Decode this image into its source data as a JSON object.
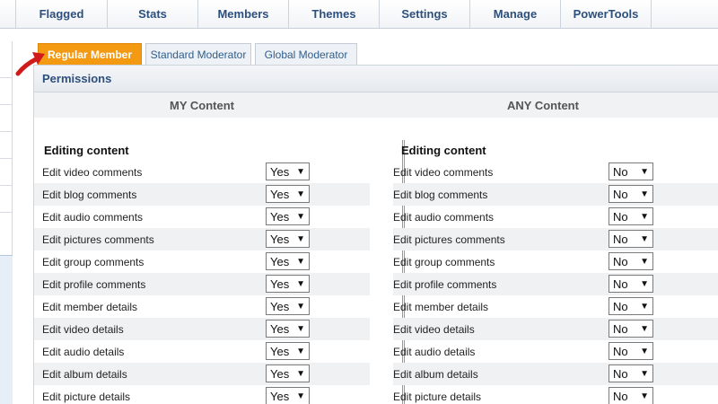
{
  "nav": {
    "items": [
      {
        "label": "Flagged"
      },
      {
        "label": "Stats"
      },
      {
        "label": "Members"
      },
      {
        "label": "Themes"
      },
      {
        "label": "Settings"
      },
      {
        "label": "Manage"
      },
      {
        "label": "PowerTools"
      }
    ]
  },
  "tabs": [
    {
      "label": "Regular Member",
      "active": true
    },
    {
      "label": "Standard Moderator",
      "active": false
    },
    {
      "label": "Global Moderator",
      "active": false
    }
  ],
  "panel": {
    "title": "Permissions",
    "my_title": "MY Content",
    "any_title": "ANY Content",
    "section_title": "Editing content"
  },
  "permissions": [
    {
      "label": "Edit video comments",
      "my": "Yes",
      "any": "No"
    },
    {
      "label": "Edit blog comments",
      "my": "Yes",
      "any": "No"
    },
    {
      "label": "Edit audio comments",
      "my": "Yes",
      "any": "No"
    },
    {
      "label": "Edit pictures comments",
      "my": "Yes",
      "any": "No"
    },
    {
      "label": "Edit group comments",
      "my": "Yes",
      "any": "No"
    },
    {
      "label": "Edit profile comments",
      "my": "Yes",
      "any": "No"
    },
    {
      "label": "Edit member details",
      "my": "Yes",
      "any": "No"
    },
    {
      "label": "Edit video details",
      "my": "Yes",
      "any": "No"
    },
    {
      "label": "Edit audio details",
      "my": "Yes",
      "any": "No"
    },
    {
      "label": "Edit album details",
      "my": "Yes",
      "any": "No"
    },
    {
      "label": "Edit picture details",
      "my": "Yes",
      "any": "No"
    }
  ],
  "icons": {
    "select_caret": "▼"
  },
  "colors": {
    "active_tab": "#f39a12",
    "nav_text": "#2d4f7d",
    "arrow": "#d11a1a"
  }
}
